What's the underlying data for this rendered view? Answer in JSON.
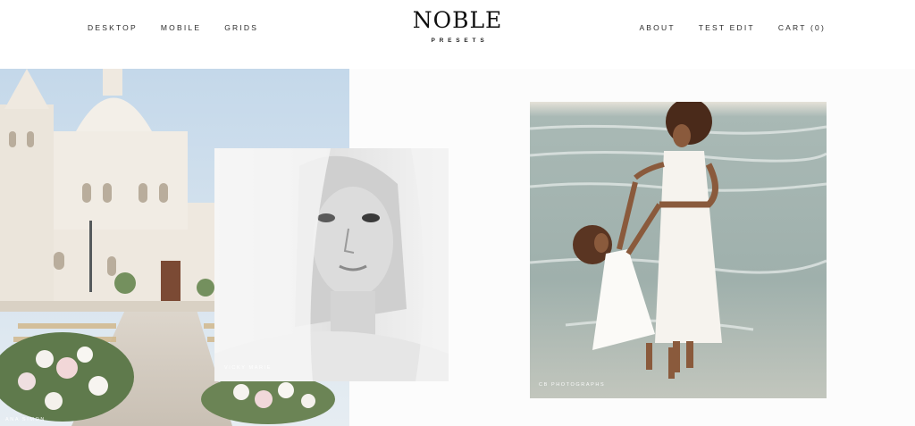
{
  "header": {
    "nav_left": [
      {
        "label": "DESKTOP"
      },
      {
        "label": "MOBILE"
      },
      {
        "label": "GRIDS"
      }
    ],
    "logo": {
      "main": "NOBLE",
      "sub": "PRESETS"
    },
    "nav_right": [
      {
        "label": "ABOUT"
      },
      {
        "label": "TEST EDIT"
      },
      {
        "label": "CART (0)"
      }
    ]
  },
  "gallery": {
    "photo_1": {
      "subject": "wedding aisle at white castle",
      "credit": "ANA SIMON"
    },
    "photo_2": {
      "subject": "black and white bride portrait with veil",
      "credit": "VICKY MARIE"
    },
    "photo_3": {
      "subject": "mother and daughter at beach",
      "credit": "CB PHOTOGRAPHS"
    }
  },
  "colors": {
    "background": "#ffffff",
    "text": "#1a1a1a",
    "sky": "#c9dbe9",
    "stone": "#ece6dc",
    "sea": "#9fb2ae"
  }
}
